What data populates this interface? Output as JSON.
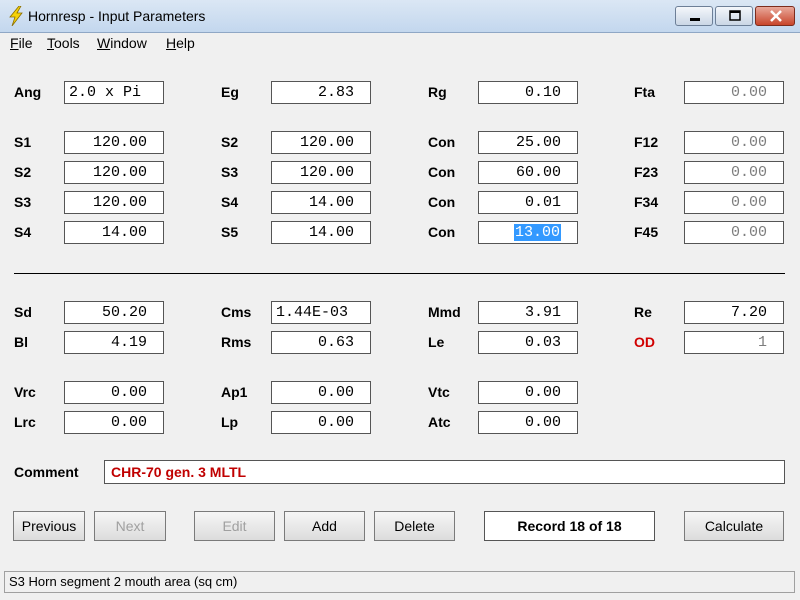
{
  "window": {
    "title": "Hornresp - Input Parameters"
  },
  "menu": [
    "File",
    "Tools",
    "Window",
    "Help"
  ],
  "row0": [
    {
      "label": "Ang",
      "value": "2.0 x Pi"
    },
    {
      "label": "Eg",
      "value": "2.83"
    },
    {
      "label": "Rg",
      "value": "0.10"
    },
    {
      "label": "Fta",
      "value": "0.00"
    }
  ],
  "row1": [
    {
      "label": "S1",
      "value": "120.00"
    },
    {
      "label": "S2",
      "value": "120.00"
    },
    {
      "label": "Con",
      "value": "25.00"
    },
    {
      "label": "F12",
      "value": "0.00"
    }
  ],
  "row2": [
    {
      "label": "S2",
      "value": "120.00"
    },
    {
      "label": "S3",
      "value": "120.00"
    },
    {
      "label": "Con",
      "value": "60.00"
    },
    {
      "label": "F23",
      "value": "0.00"
    }
  ],
  "row3": [
    {
      "label": "S3",
      "value": "120.00"
    },
    {
      "label": "S4",
      "value": "14.00"
    },
    {
      "label": "Con",
      "value": "0.01"
    },
    {
      "label": "F34",
      "value": "0.00"
    }
  ],
  "row4": [
    {
      "label": "S4",
      "value": "14.00"
    },
    {
      "label": "S5",
      "value": "14.00"
    },
    {
      "label": "Con",
      "value": "13.00"
    },
    {
      "label": "F45",
      "value": "0.00"
    }
  ],
  "row5": [
    {
      "label": "Sd",
      "value": "50.20"
    },
    {
      "label": "Cms",
      "value": "1.44E-03"
    },
    {
      "label": "Mmd",
      "value": "3.91"
    },
    {
      "label": "Re",
      "value": "7.20"
    }
  ],
  "row6": [
    {
      "label": "Bl",
      "value": "4.19"
    },
    {
      "label": "Rms",
      "value": "0.63"
    },
    {
      "label": "Le",
      "value": "0.03"
    },
    {
      "label": "OD",
      "value": "1"
    }
  ],
  "row7": [
    {
      "label": "Vrc",
      "value": "0.00"
    },
    {
      "label": "Ap1",
      "value": "0.00"
    },
    {
      "label": "Vtc",
      "value": "0.00"
    }
  ],
  "row8": [
    {
      "label": "Lrc",
      "value": "0.00"
    },
    {
      "label": "Lp",
      "value": "0.00"
    },
    {
      "label": "Atc",
      "value": "0.00"
    }
  ],
  "comment": {
    "label": "Comment",
    "value": "CHR-70 gen. 3 MLTL"
  },
  "buttons": {
    "previous": "Previous",
    "next": "Next",
    "edit": "Edit",
    "add": "Add",
    "delete": "Delete",
    "record": "Record 18 of 18",
    "calculate": "Calculate"
  },
  "status": "S3  Horn segment 2 mouth area  (sq cm)",
  "colors": {
    "accent_red": "#d00000",
    "selection": "#3399ff"
  }
}
